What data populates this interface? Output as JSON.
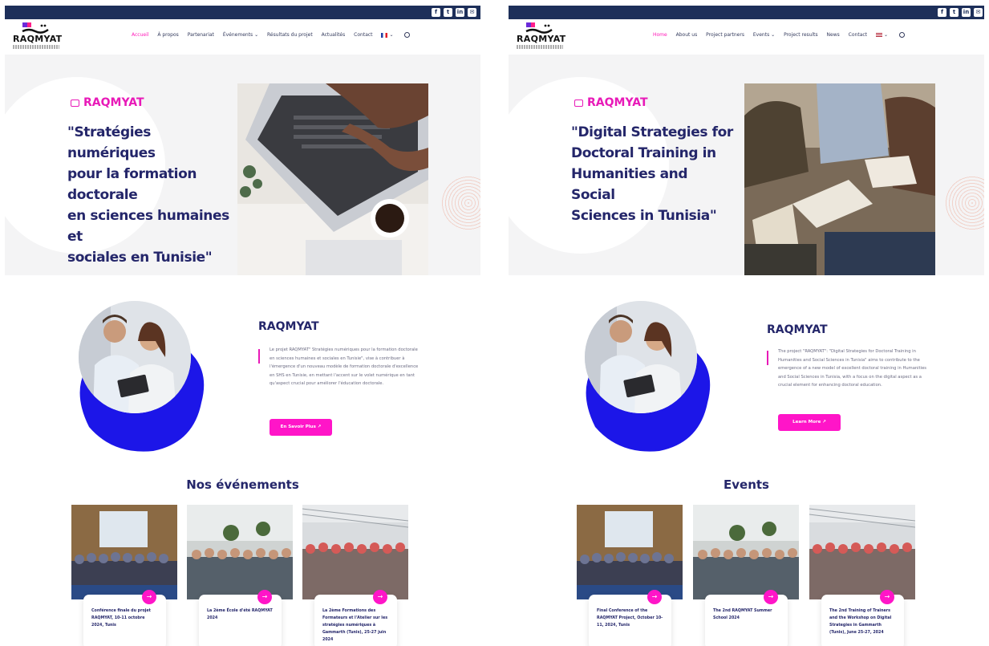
{
  "colors": {
    "topbar": "#1d2f5a",
    "accent": "#ff15c8",
    "heading": "#24266a",
    "hero_bg": "#f4f4f5",
    "blob": "#1c16e8"
  },
  "social_icons": [
    "facebook-icon",
    "twitter-icon",
    "linkedin-icon",
    "email-icon"
  ],
  "social_glyphs": [
    "f",
    "t",
    "in",
    "✉"
  ],
  "logo": {
    "arabic": "رقميات",
    "word": "RAQMYAT"
  },
  "fr": {
    "nav": [
      "Accueil",
      "À propos",
      "Partenariat",
      "Événements ⌄",
      "Résultats du projet",
      "Actualités",
      "Contact"
    ],
    "hero_tag": "RAQMYAT",
    "hero_title": "\"Stratégies numériques\npour la formation\ndoctorale\nen sciences humaines et\nsociales en Tunisie\"",
    "about_title": "RAQMYAT",
    "about_text": "Le projet RAQMYAT\" Stratégies numériques pour la formation doctorale en sciences humaines et sociales en Tunisie\", vise à contribuer à l'émergence d'un nouveau modèle de formation doctorale d'excellence en SHS en Tunisie, en mettant l'accent sur le volet numérique en tant qu'aspect crucial pour améliorer l'éducation doctorale.",
    "about_button": "En Savoir Plus ↗",
    "events_title": "Nos événements",
    "events": [
      "Conférence finale du projet RAQMYAT, 10-11 octobre 2024, Tunis",
      "La 2ème École d'été RAQMYAT 2024",
      "La 2ème Formations des Formateurs et l'Atelier sur les stratégies numériques à Gammarth (Tunis), 25-27 juin 2024"
    ]
  },
  "en": {
    "nav": [
      "Home",
      "About us",
      "Project partners",
      "Events ⌄",
      "Project results",
      "News",
      "Contact"
    ],
    "hero_tag": "RAQMYAT",
    "hero_title": "\"Digital Strategies for\nDoctoral Training in\nHumanities and Social\nSciences in Tunisia\"",
    "about_title": "RAQMYAT",
    "about_text": "The project \"RAQMYAT\": \"Digital Strategies for Doctoral Training in Humanities and Social Sciences in Tunisia\" aims to contribute to the emergence of a new model of excellent doctoral training in Humanities and Social Sciences in Tunisia, with a focus on the digital aspect as a crucial element for enhancing doctoral education.",
    "about_button": "Learn More ↗",
    "events_title": "Events",
    "events": [
      "Final Conference of the RAQMYAT Project, October 10-11, 2024, Tunis",
      "The 2nd RAQMYAT Summer School 2024",
      "The 2nd Training of Trainers and the Workshop on Digital Strategies in Gammarth (Tunis), June 25-27, 2024"
    ]
  }
}
